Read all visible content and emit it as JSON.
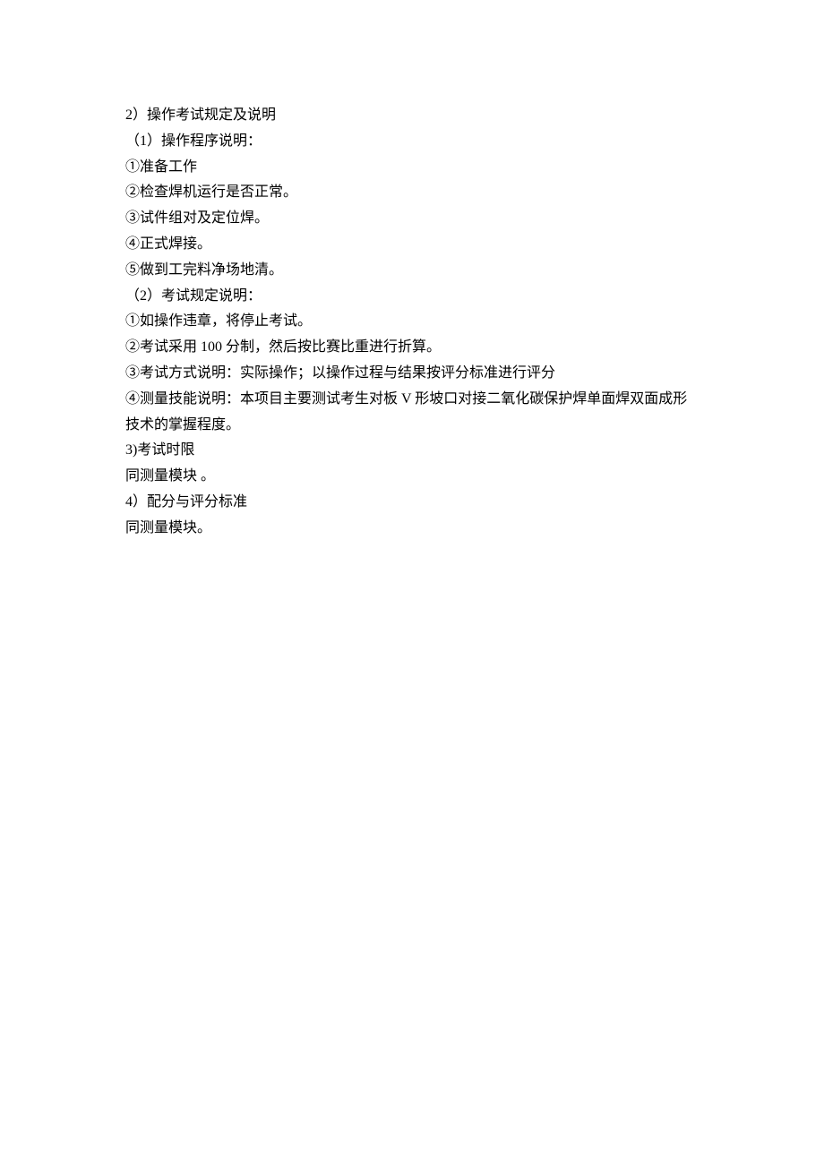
{
  "lines": [
    "2）操作考试规定及说明",
    "（1）操作程序说明：",
    "①准备工作",
    "②检查焊机运行是否正常。",
    "③试件组对及定位焊。",
    "④正式焊接。",
    "⑤做到工完料净场地清。",
    "（2）考试规定说明：",
    "①如操作违章，将停止考试。",
    "②考试采用 100 分制，然后按比赛比重进行折算。",
    "③考试方式说明：实际操作；以操作过程与结果按评分标准进行评分",
    "④测量技能说明：本项目主要测试考生对板 V 形坡口对接二氧化碳保护焊单面焊双面成形技术的掌握程度。",
    "3)考试时限",
    "同测量模块 。",
    "4）配分与评分标准",
    "同测量模块。"
  ]
}
